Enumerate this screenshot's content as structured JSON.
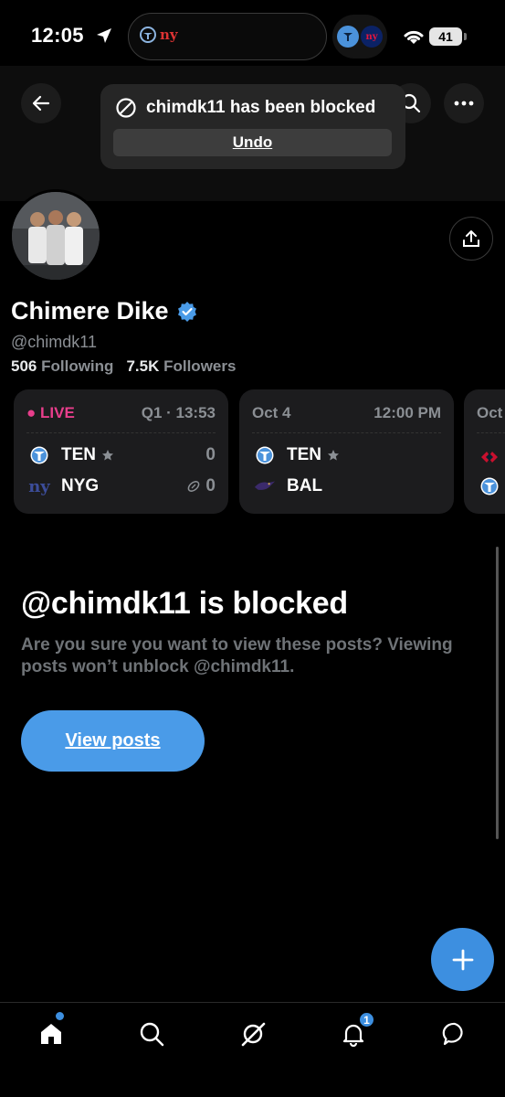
{
  "status_bar": {
    "time": "12:05",
    "battery": "41",
    "island_teams": [
      "TEN",
      "ny"
    ]
  },
  "toast": {
    "message": "chimdk11 has been blocked",
    "undo_label": "Undo"
  },
  "profile": {
    "name": "Chimere Dike",
    "handle": "@chimdk11",
    "following_count": "506",
    "following_label": "Following",
    "followers_count": "7.5K",
    "followers_label": "Followers",
    "verified": true
  },
  "scores": [
    {
      "status": "LIVE",
      "clock": "Q1 · 13:53",
      "home": {
        "team": "TEN",
        "score": "0",
        "icon": "titans-logo-icon"
      },
      "away": {
        "team": "NYG",
        "score": "0",
        "icon": "giants-logo-icon"
      }
    },
    {
      "date": "Oct 4",
      "time": "12:00 PM",
      "home": {
        "team": "TEN",
        "icon": "titans-logo-icon"
      },
      "away": {
        "team": "BAL",
        "icon": "ravens-logo-icon"
      }
    },
    {
      "date": "Oct"
    }
  ],
  "blocked": {
    "title": "@chimdk11 is blocked",
    "description": "Are you sure you want to view these posts? Viewing posts won’t unblock @chimdk11.",
    "button_label": "View posts"
  },
  "nav": {
    "items": [
      "home-icon",
      "search-icon",
      "grok-icon",
      "notifications-icon",
      "messages-icon"
    ],
    "notification_count": "1"
  },
  "colors": {
    "accent": "#4a9be8",
    "live": "#e83e8c",
    "background": "#000000"
  }
}
